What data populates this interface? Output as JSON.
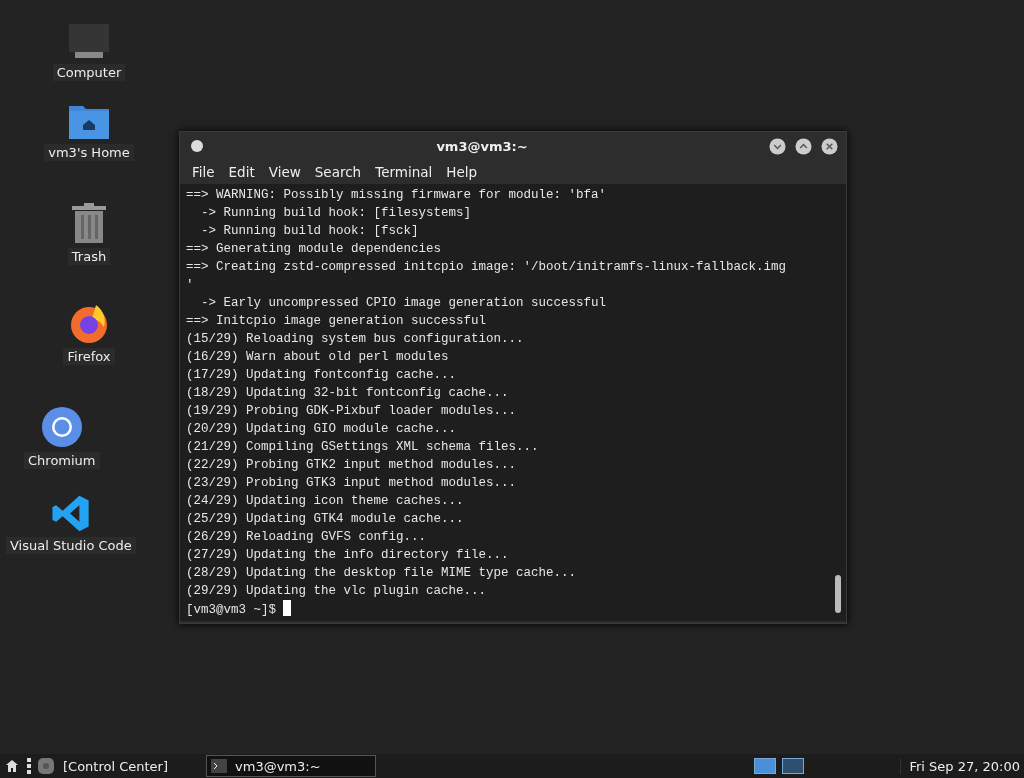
{
  "desktop_icons": [
    {
      "kind": "computer",
      "label": "Computer"
    },
    {
      "kind": "home",
      "label": "vm3's Home"
    },
    {
      "kind": "trash",
      "label": "Trash"
    },
    {
      "kind": "firefox",
      "label": "Firefox"
    },
    {
      "kind": "chromium",
      "label": "Chromium"
    },
    {
      "kind": "vscode",
      "label": "Visual Studio Code"
    }
  ],
  "window": {
    "title": "vm3@vm3:~",
    "menu": [
      "File",
      "Edit",
      "View",
      "Search",
      "Terminal",
      "Help"
    ],
    "lines": [
      "==> WARNING: Possibly missing firmware for module: 'bfa'",
      "  -> Running build hook: [filesystems]",
      "  -> Running build hook: [fsck]",
      "==> Generating module dependencies",
      "==> Creating zstd-compressed initcpio image: '/boot/initramfs-linux-fallback.img",
      "'",
      "  -> Early uncompressed CPIO image generation successful",
      "==> Initcpio image generation successful",
      "(15/29) Reloading system bus configuration...",
      "(16/29) Warn about old perl modules",
      "(17/29) Updating fontconfig cache...",
      "(18/29) Updating 32-bit fontconfig cache...",
      "(19/29) Probing GDK-Pixbuf loader modules...",
      "(20/29) Updating GIO module cache...",
      "(21/29) Compiling GSettings XML schema files...",
      "(22/29) Probing GTK2 input method modules...",
      "(23/29) Probing GTK3 input method modules...",
      "(24/29) Updating icon theme caches...",
      "(25/29) Updating GTK4 module cache...",
      "(26/29) Reloading GVFS config...",
      "(27/29) Updating the info directory file...",
      "(28/29) Updating the desktop file MIME type cache...",
      "(29/29) Updating the vlc plugin cache..."
    ],
    "prompt": "[vm3@vm3 ~]$"
  },
  "taskbar": {
    "launcher": "[Control Center]",
    "tasks": [
      {
        "label": "vm3@vm3:~",
        "selected": true
      }
    ],
    "workspaces": [
      {
        "selected": true
      },
      {
        "selected": false
      }
    ],
    "clock": "Fri Sep 27, 20:00"
  }
}
